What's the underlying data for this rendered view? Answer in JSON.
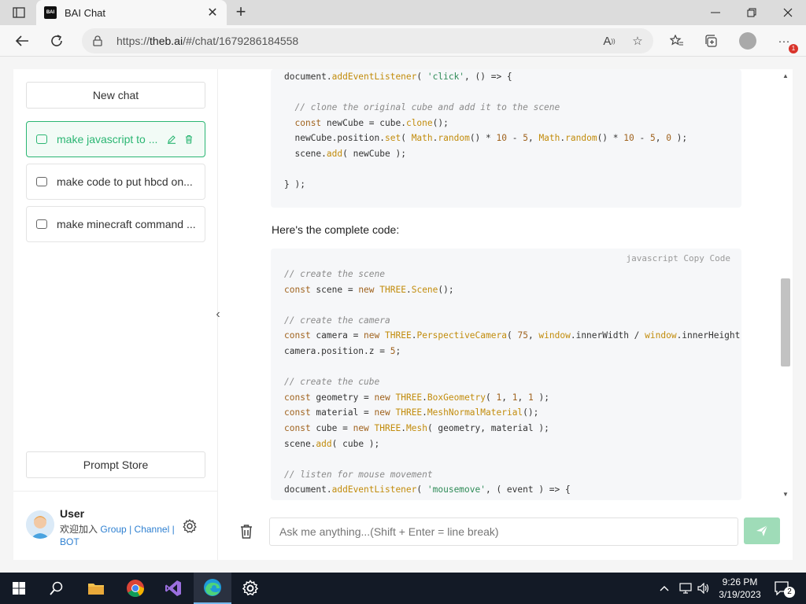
{
  "browser": {
    "tab_title": "BAI Chat",
    "favicon_text": "BAI",
    "url_prefix": "https://",
    "url_host": "theb.ai",
    "url_path": "/#/chat/1679286184558",
    "notification_count": "1"
  },
  "sidebar": {
    "new_chat_label": "New chat",
    "chats": [
      {
        "label": "make javascript to ..."
      },
      {
        "label": "make code to put hbcd on..."
      },
      {
        "label": "make minecraft command ..."
      }
    ],
    "prompt_store_label": "Prompt Store",
    "user": {
      "name": "User",
      "join_text": "欢迎加入",
      "links": [
        "Group",
        "Channel",
        "BOT"
      ]
    }
  },
  "main": {
    "complete_code_text": "Here's the complete code:",
    "code_toolbar_lang": "javascript",
    "code_toolbar_copy": "Copy Code",
    "input_placeholder": "Ask me anything...(Shift + Enter = line break)"
  },
  "taskbar": {
    "time": "9:26 PM",
    "date": "3/19/2023",
    "notifications": "2"
  },
  "icons": [
    "tab-actions-icon",
    "favicon",
    "close-icon",
    "plus-icon",
    "minimize-icon",
    "restore-icon",
    "window-close-icon",
    "back-icon",
    "refresh-icon",
    "lock-icon",
    "read-aloud-icon",
    "add-favorite-icon",
    "favorites-icon",
    "collections-icon",
    "profile-icon",
    "more-icon",
    "chat-icon",
    "edit-icon",
    "delete-icon",
    "settings-icon",
    "chevron-left-icon",
    "trash-icon",
    "send-icon",
    "windows-icon",
    "search-icon",
    "file-explorer-icon",
    "chrome-icon",
    "visual-studio-icon",
    "edge-icon",
    "settings-app-icon",
    "chevron-up-icon",
    "network-icon",
    "volume-icon",
    "notification-icon"
  ]
}
